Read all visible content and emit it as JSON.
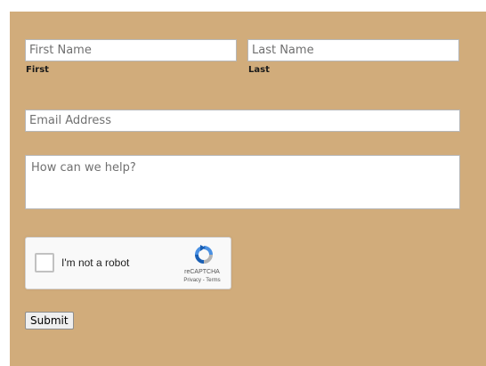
{
  "form": {
    "first_name": {
      "placeholder": "First Name",
      "sublabel": "First"
    },
    "last_name": {
      "placeholder": "Last Name",
      "sublabel": "Last"
    },
    "email": {
      "placeholder": "Email Address"
    },
    "message": {
      "placeholder": "How can we help?"
    },
    "submit_label": "Submit"
  },
  "captcha": {
    "checkbox_label": "I'm not a robot",
    "brand": "reCAPTCHA",
    "links": "Privacy - Terms"
  },
  "colors": {
    "panel_background": "#d1ac7b",
    "page_background": "#ffffff"
  }
}
